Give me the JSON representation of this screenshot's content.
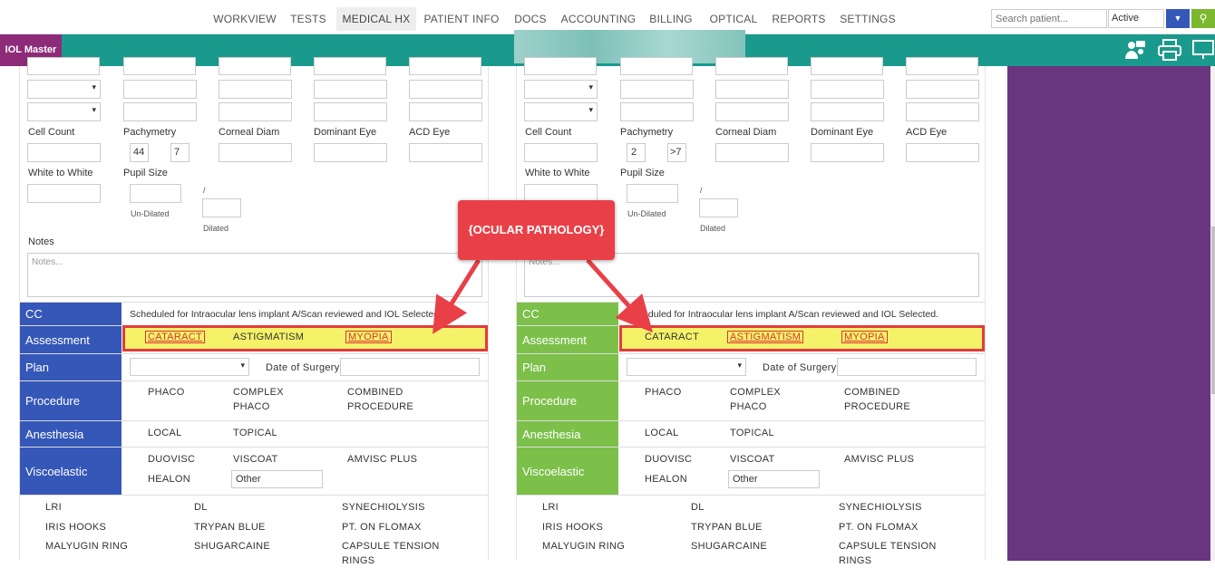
{
  "nav": {
    "items": [
      {
        "label": "WORKVIEW",
        "active": false
      },
      {
        "label": "TESTS",
        "active": false
      },
      {
        "label": "MEDICAL HX",
        "active": true
      },
      {
        "label": "PATIENT INFO",
        "active": false
      },
      {
        "label": "DOCS",
        "active": false
      },
      {
        "label": "ACCOUNTING",
        "active": false
      },
      {
        "label": "BILLING",
        "active": false
      },
      {
        "label": "OPTICAL",
        "active": false
      },
      {
        "label": "REPORTS",
        "active": false
      },
      {
        "label": "SETTINGS",
        "active": false
      }
    ],
    "search_placeholder": "Search patient...",
    "status": "Active"
  },
  "toolbar": {
    "title": "IOL Master",
    "icons": [
      "team-icon",
      "printer-icon",
      "monitor-icon"
    ]
  },
  "callout": "{OCULAR PATHOLOGY}",
  "colors": {
    "teal": "#1a9a8c",
    "blue_header": "#3557b7",
    "green_header": "#7cc04a",
    "purple": "#6a357f",
    "callout": "#e94048",
    "highlight": "#f5f26a"
  },
  "labels": {
    "cell_count": "Cell Count",
    "pachymetry": "Pachymetry",
    "corneal_diam": "Corneal Diam",
    "dominant_eye": "Dominant Eye",
    "acd_eye": "ACD Eye",
    "white_to_white": "White to White",
    "pupil_size": "Pupil Size",
    "un_dilated": "Un-Dilated",
    "dilated": "Dilated",
    "slash": "/",
    "notes": "Notes",
    "notes_placeholder": "Notes...",
    "date_of_surgery": "Date of Surgery"
  },
  "left": {
    "pachymetry": [
      "44",
      "7"
    ],
    "rows": {
      "cc": "CC",
      "assessment": "Assessment",
      "plan": "Plan",
      "procedure": "Procedure",
      "anesthesia": "Anesthesia",
      "viscoelastic": "Viscoelastic"
    },
    "cc_text": "Scheduled for Intraocular lens implant A/Scan reviewed and IOL Selected.",
    "assessment": [
      "CATARACT",
      "ASTIGMATISM",
      "MYOPIA"
    ],
    "procedure": [
      "PHACO",
      "COMPLEX PHACO",
      "COMBINED PROCEDURE"
    ],
    "anesthesia": [
      "LOCAL",
      "TOPICAL"
    ],
    "viscoelastic": [
      "DUOVISC",
      "VISCOAT",
      "AMVISC PLUS",
      "HEALON"
    ],
    "other_value": "Other",
    "extras": [
      "LRI",
      "DL",
      "SYNECHIOLYSIS",
      "IRIS HOOKS",
      "TRYPAN BLUE",
      "PT. ON FLOMAX",
      "MALYUGIN RING",
      "SHUGARCAINE",
      "CAPSULE TENSION RINGS"
    ]
  },
  "right": {
    "pachymetry": [
      "2",
      ">7"
    ],
    "cc_text": "Scheduled for Intraocular lens implant A/Scan reviewed and IOL Selected.",
    "assessment": [
      "CATARACT",
      "ASTIGMATISM",
      "MYOPIA"
    ],
    "procedure": [
      "PHACO",
      "COMPLEX PHACO",
      "COMBINED PROCEDURE"
    ],
    "anesthesia": [
      "LOCAL",
      "TOPICAL"
    ],
    "viscoelastic": [
      "DUOVISC",
      "VISCOAT",
      "AMVISC PLUS",
      "HEALON"
    ],
    "other_value": "Other",
    "extras": [
      "LRI",
      "DL",
      "SYNECHIOLYSIS",
      "IRIS HOOKS",
      "TRYPAN BLUE",
      "PT. ON FLOMAX",
      "MALYUGIN RING",
      "SHUGARCAINE",
      "CAPSULE TENSION RINGS"
    ]
  }
}
